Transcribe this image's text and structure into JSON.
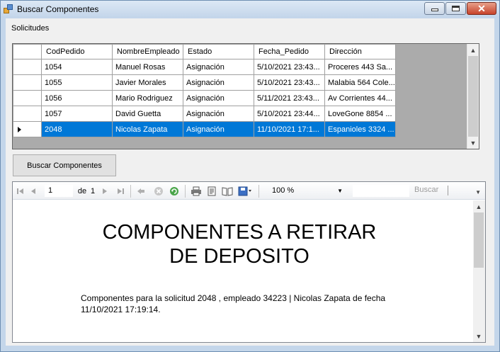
{
  "window": {
    "title": "Buscar Componentes"
  },
  "labels": {
    "solicitudes": "Solicitudes"
  },
  "grid": {
    "columns": [
      "CodPedido",
      "NombreEmpleado",
      "Estado",
      "Fecha_Pedido",
      "Dirección"
    ],
    "rows": [
      [
        "1054",
        "Manuel Rosas",
        "Asignación",
        "5/10/2021 23:43...",
        "Proceres 443 Sa..."
      ],
      [
        "1055",
        "Javier Morales",
        "Asignación",
        "5/10/2021 23:43...",
        "Malabia 564 Cole..."
      ],
      [
        "1056",
        "Mario Rodriguez",
        "Asignación",
        "5/11/2021 23:43...",
        "Av Corrientes 44..."
      ],
      [
        "1057",
        "David Guetta",
        "Asignación",
        "5/10/2021 23:44...",
        "LoveGone 8854 ..."
      ],
      [
        "2048",
        "Nicolas Zapata",
        "Asignación",
        "11/10/2021 17:1...",
        "Espanioles 3324 ..."
      ]
    ],
    "selected_row": 4
  },
  "buttons": {
    "buscar_componentes": "Buscar Componentes"
  },
  "report_toolbar": {
    "page_current": "1",
    "page_of": "de",
    "page_total": "1",
    "zoom": "100 %",
    "find_label": "Buscar"
  },
  "report": {
    "title_line1": "COMPONENTES A RETIRAR",
    "title_line2": "DE DEPOSITO",
    "description": "Componentes para la solicitud 2048 , empleado 34223 | Nicolas Zapata de fecha 11/10/2021 17:19:14."
  },
  "colors": {
    "selection": "#0078d7",
    "close_button": "#c7422a",
    "titlebar": "#c3d5ea"
  }
}
